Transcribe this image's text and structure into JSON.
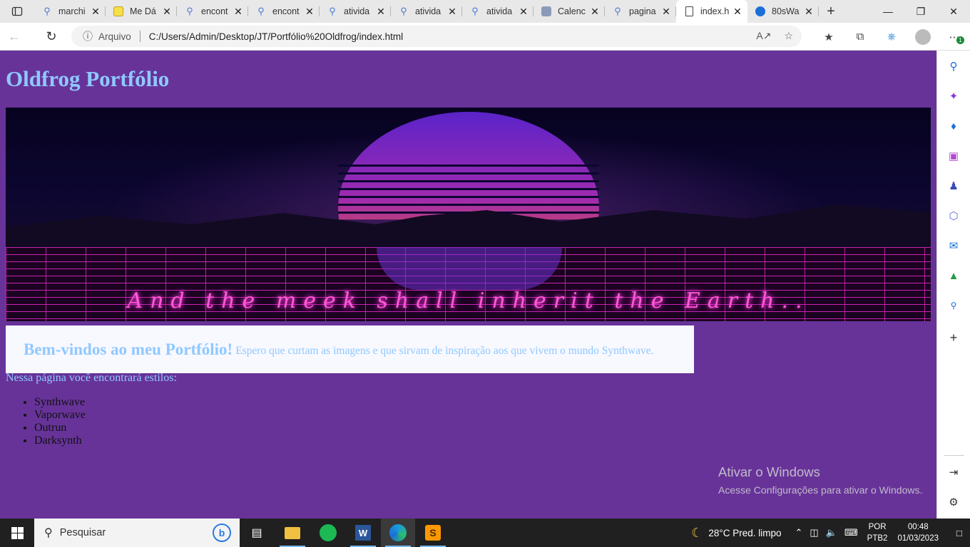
{
  "browser": {
    "tabs": [
      {
        "label": "marchi",
        "icon": "search-icon"
      },
      {
        "label": "Me Dá",
        "icon": "image-icon"
      },
      {
        "label": "encont",
        "icon": "search-icon"
      },
      {
        "label": "encont",
        "icon": "search-icon"
      },
      {
        "label": "ativida",
        "icon": "search-icon"
      },
      {
        "label": "ativida",
        "icon": "search-icon"
      },
      {
        "label": "ativida",
        "icon": "search-icon"
      },
      {
        "label": "Calenc",
        "icon": "calendar-icon"
      },
      {
        "label": "pagina",
        "icon": "search-icon"
      },
      {
        "label": "index.h",
        "icon": "document-icon",
        "active": true
      },
      {
        "label": "80sWa",
        "icon": "edge-icon"
      }
    ],
    "address": {
      "scheme_label": "Arquivo",
      "url": "C:/Users/Admin/Desktop/JT/Portfólio%20Oldfrog/index.html"
    },
    "notification_badge": "1"
  },
  "page": {
    "title": "Oldfrog Portfólio",
    "banner_tagline": "And the meek shall inherit the Earth..",
    "welcome_heading": "Bem-vindos ao meu Portfólio!",
    "welcome_text": "Espero que curtam as imagens e que sirvam de inspiração aos que vivem o mundo Synthwave.",
    "intro": "Nessa página você encontrará estilos:",
    "styles": [
      "Synthwave",
      "Vaporwave",
      "Outrun",
      "Darksynth"
    ]
  },
  "watermark": {
    "line1": "Ativar o Windows",
    "line2": "Acesse Configurações para ativar o Windows."
  },
  "taskbar": {
    "search_placeholder": "Pesquisar",
    "weather": "28°C  Pred. limpo",
    "lang_line1": "POR",
    "lang_line2": "PTB2",
    "time": "00:48",
    "date": "01/03/2023"
  },
  "colors": {
    "page_background": "#673399",
    "accent_text": "#8fc9ff",
    "welcome_box": "#f8f8ff",
    "taskbar": "#202020"
  }
}
